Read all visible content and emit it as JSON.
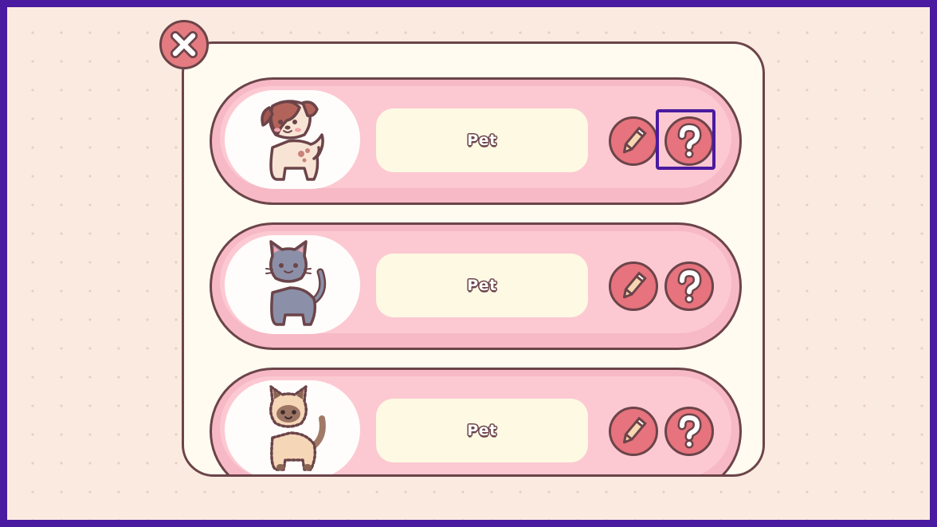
{
  "dialog": {
    "close_icon": "close-x-icon",
    "pets": [
      {
        "name": "Pet",
        "species": "dog",
        "edit_icon": "pencil-icon",
        "help_icon": "question-mark-icon"
      },
      {
        "name": "Pet",
        "species": "gray-cat",
        "edit_icon": "pencil-icon",
        "help_icon": "question-mark-icon"
      },
      {
        "name": "Pet",
        "species": "siamese-cat",
        "edit_icon": "pencil-icon",
        "help_icon": "question-mark-icon"
      }
    ]
  },
  "colors": {
    "frame_border": "#4a1aa0",
    "background": "#fbeae0",
    "panel": "#fffbf0",
    "card": "#f6b9c5",
    "button": "#e6737d",
    "outline": "#6b4449",
    "name_field": "#fef9e3",
    "highlight": "#4a1aa0"
  }
}
